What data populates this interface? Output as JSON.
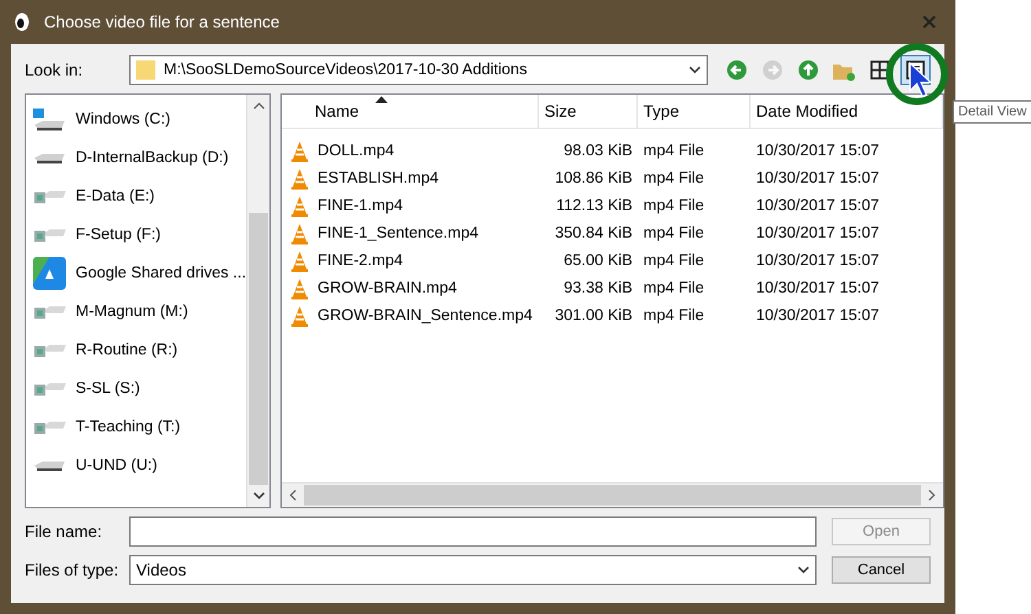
{
  "window": {
    "title": "Choose video file for a sentence"
  },
  "look_in": {
    "label": "Look in:",
    "path": "M:\\SooSLDemoSourceVideos\\2017-10-30 Additions"
  },
  "toolbar": [
    {
      "kind": "back",
      "disabled": false,
      "selected": false
    },
    {
      "kind": "forward",
      "disabled": true,
      "selected": false
    },
    {
      "kind": "up",
      "disabled": false,
      "selected": false
    },
    {
      "kind": "new-folder",
      "disabled": false,
      "selected": false
    },
    {
      "kind": "list-view",
      "disabled": false,
      "selected": false
    },
    {
      "kind": "detail-view",
      "disabled": false,
      "selected": true
    }
  ],
  "tooltip": "Detail View",
  "sidebar": {
    "items": [
      {
        "label": "Windows (C:)",
        "kind": "system"
      },
      {
        "label": "D-InternalBackup (D:)",
        "kind": "drive"
      },
      {
        "label": "E-Data (E:)",
        "kind": "network"
      },
      {
        "label": "F-Setup (F:)",
        "kind": "network"
      },
      {
        "label": "Google Shared drives ...",
        "kind": "cloud"
      },
      {
        "label": "M-Magnum (M:)",
        "kind": "network"
      },
      {
        "label": "R-Routine (R:)",
        "kind": "network"
      },
      {
        "label": "S-SL (S:)",
        "kind": "network"
      },
      {
        "label": "T-Teaching (T:)",
        "kind": "network"
      },
      {
        "label": "U-UND (U:)",
        "kind": "drive"
      }
    ]
  },
  "table": {
    "columns": [
      {
        "label": "Name",
        "sorted": true
      },
      {
        "label": "Size",
        "sorted": false
      },
      {
        "label": "Type",
        "sorted": false
      },
      {
        "label": "Date Modified",
        "sorted": false
      }
    ],
    "rows": [
      [
        "DOLL.mp4",
        "98.03 KiB",
        "mp4 File",
        "10/30/2017 15:07"
      ],
      [
        "ESTABLISH.mp4",
        "108.86 KiB",
        "mp4 File",
        "10/30/2017 15:07"
      ],
      [
        "FINE-1.mp4",
        "112.13 KiB",
        "mp4 File",
        "10/30/2017 15:07"
      ],
      [
        "FINE-1_Sentence.mp4",
        "350.84 KiB",
        "mp4 File",
        "10/30/2017 15:07"
      ],
      [
        "FINE-2.mp4",
        "65.00 KiB",
        "mp4 File",
        "10/30/2017 15:07"
      ],
      [
        "GROW-BRAIN.mp4",
        "93.38 KiB",
        "mp4 File",
        "10/30/2017 15:07"
      ],
      [
        "GROW-BRAIN_Sentence.mp4",
        "301.00 KiB",
        "mp4 File",
        "10/30/2017 15:07"
      ]
    ]
  },
  "file_name": {
    "label": "File name:"
  },
  "file_type": {
    "label": "Files of type:",
    "value": "Videos"
  },
  "buttons": [
    {
      "label": "Open",
      "disabled": true
    },
    {
      "label": "Cancel",
      "disabled": false
    }
  ]
}
